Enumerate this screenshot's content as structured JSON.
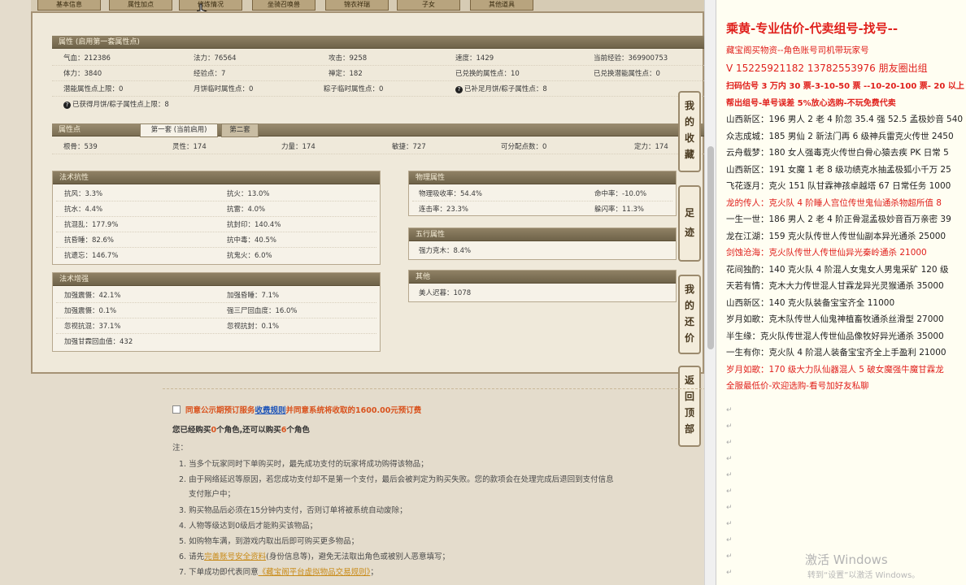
{
  "tabs": [
    "基本信息",
    "属性加点",
    "修炼情况",
    "坐骑召唤兽",
    "锦衣祥瑞",
    "子女",
    "其他道具"
  ],
  "attr1": {
    "header": "属性 (启用第一套属性点)",
    "rows": [
      [
        "气血：212386",
        "法力：76564",
        "攻击：9258",
        "速度：1429",
        "当前经验：369900753"
      ],
      [
        "体力：3840",
        "经验点：7",
        "禅定：182",
        "已兑换的属性点：10",
        "已兑换潜能属性点：0"
      ],
      [
        "潜能属性点上限：0",
        "月饼临时属性点：0",
        "粽子临时属性点：0",
        "已补足月饼/粽子属性点：8"
      ]
    ],
    "last": "已获得月饼/粽子属性点上限：8"
  },
  "attr2": {
    "header": "属性点",
    "tab_active": "第一套 (当前启用)",
    "tab_other": "第二套",
    "row": [
      "根骨：539",
      "灵性：174",
      "力量：174",
      "敏捷：727",
      "可分配点数：0",
      "定力：174"
    ]
  },
  "resist": {
    "header": "法术抗性",
    "rows": [
      [
        "抗风：3.3%",
        "抗火：13.0%"
      ],
      [
        "抗水：4.4%",
        "抗雷：4.0%"
      ],
      [
        "抗混乱：177.9%",
        "抗封印：140.4%"
      ],
      [
        "抗昏睡：82.6%",
        "抗中毒：40.5%"
      ],
      [
        "抗遗忘：146.7%",
        "抗鬼火：6.0%"
      ]
    ]
  },
  "enhance": {
    "header": "法术增强",
    "rows": [
      [
        "加强震慑：42.1%",
        "加强昏睡：7.1%"
      ],
      [
        "加强震慑：0.1%",
        "强三尸回血度：16.0%"
      ],
      [
        "忽视抗混：37.1%",
        "忽视抗封：0.1%"
      ],
      [
        "加强甘霖回血值：432",
        ""
      ]
    ]
  },
  "physical": {
    "header": "物理属性",
    "rows": [
      [
        "物理吸收率：54.4%",
        "命中率：-10.0%"
      ],
      [
        "连击率：23.3%",
        "躲闪率：11.3%"
      ]
    ]
  },
  "five": {
    "header": "五行属性",
    "row": "强力克木：8.4%"
  },
  "other": {
    "header": "其他",
    "row": "美人迟暮：1078"
  },
  "side_buttons": [
    "我的收藏",
    "足迹",
    "我的还价",
    "返回顶部"
  ],
  "notice": {
    "agree_a": "同意公示期预订服务",
    "agree_link": "收费规则",
    "agree_b": "并同意系统将收取的1600.00元预订费",
    "bought_a": "您已经购买",
    "bought_n1": "0",
    "bought_b": "个角色,还可以购买",
    "bought_n2": "6",
    "bought_c": "个角色",
    "note": "注：",
    "items": [
      "1. 当多个玩家同时下单购买时，最先成功支付的玩家将成功购得该物品；",
      "2. 由于网络延迟等原因，若您成功支付却不是第一个支付，最后会被判定为购买失败。您的款项会在处理完成后退回到支付信息",
      "支付账户中；",
      "3. 购买物品后必须在15分钟内支付，否则订单将被系统自动废除；",
      "4. 人物等级达到0级后才能购买该物品；",
      "5. 如购物车满，到游戏内取出后即可购买更多物品；"
    ],
    "item6_a": "6. 请先",
    "item6_link": "完善账号安全资料",
    "item6_b": "(身份信息等)，避免无法取出角色或被别人恶意填写；",
    "item7_a": "7. 下单成功即代表同意",
    "item7_link": "《藏宝阁平台虚拟物品交易规则》",
    "item7_b": "；"
  },
  "doc": {
    "title": "乘黄-专业估价-代卖组号-找号--",
    "l1": "藏宝阁买物资--角色账号司机带玩家号",
    "l2": "V 15225921182   13782553976 朋友圈出组",
    "l3": "扫码估号 3 万内 30 票-3-10-50 票 --10-20-100 票- 20 以上",
    "l4": "帮出组号-单号误差 5%放心选购-不玩免费代卖",
    "lines": [
      {
        "t": "山西新区：196 男人 2 老 4 阶忽 35.4 强 52.5 孟极妙音 540",
        "red": false
      },
      {
        "t": "众志成城：185 男仙 2 新法门再 6 级神兵雷克火传世 2450",
        "red": false
      },
      {
        "t": "云舟载梦：180 女人强毒克火传世白骨心猿去疾 PK 日常 5",
        "red": false
      },
      {
        "t": "山西新区：191 女魔 1 老 8 级功绩克水抽孟极狐小千万 25",
        "red": false
      },
      {
        "t": "飞花逐月：克火 151 队甘霖神孩卓越塔 67 日常任务 1000",
        "red": false
      },
      {
        "t": "龙的传人：克火队 4 阶睡人宫位传世鬼仙通杀物超所值 8",
        "red": true
      },
      {
        "t": "一生一世：186 男人 2 老 4 阶正骨混孟极妙音百万亲密 39",
        "red": false
      },
      {
        "t": "龙在江湖：159 克火队传世人传世仙副本异光通杀 25000",
        "red": false
      },
      {
        "t": "剑蚀沧海：克火队传世人传世仙异光秦岭通杀 21000",
        "red": true
      },
      {
        "t": "花间独酌：140 克火队 4 阶混人女鬼女人男鬼采矿 120 级",
        "red": false
      },
      {
        "t": "天若有情：克木大力传世混人甘霖龙异光灵猴通杀 35000",
        "red": false
      },
      {
        "t": "山西新区：140 克火队装备宝宝齐全 11000",
        "red": false
      },
      {
        "t": "岁月如歌：克木队传世人仙鬼神植畜牧通杀丝滑型 27000",
        "red": false
      },
      {
        "t": "半生缘：克火队传世混人传世仙品像牧好异光通杀 35000",
        "red": false
      },
      {
        "t": "一生有你：克火队 4 阶混人装备宝宝齐全上手盈利 21000",
        "red": false
      },
      {
        "t": "岁月如歌：170 级大力队仙器混人 5 破女魔强牛魔甘霖龙",
        "red": true
      },
      {
        "t": "全服最低价-欢迎选购-看号加好友私聊",
        "red": true
      }
    ]
  },
  "watermark": {
    "l1": "激活 Windows",
    "l2": "转到“设置”以激活 Windows。"
  }
}
